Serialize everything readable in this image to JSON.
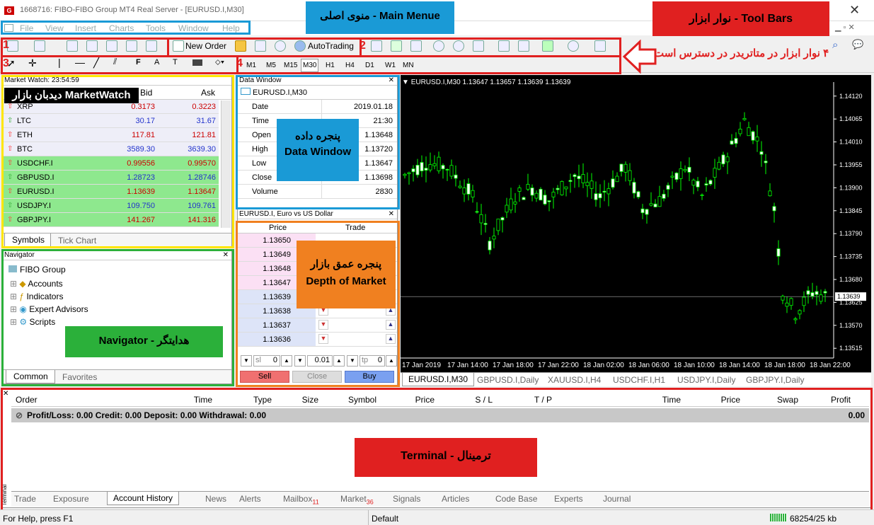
{
  "window": {
    "title": "1668716: FIBO-FIBO Group MT4 Real Server - [EURUSD.I,M30]",
    "logo": "G"
  },
  "menu": [
    "File",
    "View",
    "Insert",
    "Charts",
    "Tools",
    "Window",
    "Help"
  ],
  "toolbar": {
    "new_order": "New Order",
    "autotrading": "AutoTrading",
    "timeframes": [
      "M1",
      "M5",
      "M15",
      "M30",
      "H1",
      "H4",
      "D1",
      "W1",
      "MN"
    ]
  },
  "annotations": {
    "main_menu": "منوی اصلی - Main Menue",
    "toolbars": "نوار ابزار - Tool Bars",
    "toolbars_note": "۴ نوار ابزار در متاتریدر در دسترس است",
    "marketwatch": "دیدبان بازار MarketWatch",
    "data_window_fa": "پنجره داده",
    "data_window_en": "Data Window",
    "dom_fa": "پنجره عمق بازار",
    "dom_en": "Depth of Market",
    "navigator": "Navigator - هدایتگر",
    "terminal": "Terminal - ترمینال",
    "n1": "1",
    "n2": "2",
    "n3": "3",
    "n4": "4"
  },
  "market_watch": {
    "title": "Market Watch: 23:54:59",
    "col_bid": "Bid",
    "col_ask": "Ask",
    "rows": [
      {
        "symbol": "XRP",
        "bid": "0.3173",
        "ask": "0.3223"
      },
      {
        "symbol": "LTC",
        "bid": "30.17",
        "ask": "31.67"
      },
      {
        "symbol": "ETH",
        "bid": "117.81",
        "ask": "121.81"
      },
      {
        "symbol": "BTC",
        "bid": "3589.30",
        "ask": "3639.30"
      },
      {
        "symbol": "USDCHF.I",
        "bid": "0.99556",
        "ask": "0.99570"
      },
      {
        "symbol": "GBPUSD.I",
        "bid": "1.28723",
        "ask": "1.28746"
      },
      {
        "symbol": "EURUSD.I",
        "bid": "1.13639",
        "ask": "1.13647"
      },
      {
        "symbol": "USDJPY.I",
        "bid": "109.750",
        "ask": "109.761"
      },
      {
        "symbol": "GBPJPY.I",
        "bid": "141.267",
        "ask": "141.316"
      }
    ],
    "tabs": [
      "Symbols",
      "Tick Chart"
    ]
  },
  "data_window": {
    "title": "Data Window",
    "symbol": "EURUSD.I,M30",
    "rows": [
      {
        "label": "Date",
        "value": "2019.01.18"
      },
      {
        "label": "Time",
        "value": "21:30"
      },
      {
        "label": "Open",
        "value": "1.13648"
      },
      {
        "label": "High",
        "value": "1.13720"
      },
      {
        "label": "Low",
        "value": "1.13647"
      },
      {
        "label": "Close",
        "value": "1.13698"
      },
      {
        "label": "Volume",
        "value": "2830"
      }
    ]
  },
  "dom": {
    "title": "EURUSD.I, Euro vs US Dollar",
    "col_price": "Price",
    "col_trade": "Trade",
    "prices": [
      "1.13650",
      "1.13649",
      "1.13648",
      "1.13647",
      "1.13639",
      "1.13638",
      "1.13637",
      "1.13636"
    ],
    "sl_label": "sl",
    "sl_value": "0",
    "lot": "0.01",
    "tp_label": "tp",
    "tp_value": "0",
    "sell": "Sell",
    "close": "Close",
    "buy": "Buy"
  },
  "navigator": {
    "title": "Navigator",
    "root": "FIBO Group",
    "items": [
      "Accounts",
      "Indicators",
      "Expert Advisors",
      "Scripts"
    ],
    "tabs": [
      "Common",
      "Favorites"
    ]
  },
  "chart": {
    "header": "EURUSD.I,M30  1.13647 1.13657 1.13639 1.13639",
    "price_labels": [
      "1.14120",
      "1.14065",
      "1.14010",
      "1.13955",
      "1.13900",
      "1.13845",
      "1.13790",
      "1.13735",
      "1.13680",
      "1.13625",
      "1.13570",
      "1.13515"
    ],
    "current_price": "1.13639",
    "time_labels": [
      "17 Jan 2019",
      "17 Jan 14:00",
      "17 Jan 18:00",
      "17 Jan 22:00",
      "18 Jan 02:00",
      "18 Jan 06:00",
      "18 Jan 10:00",
      "18 Jan 14:00",
      "18 Jan 18:00",
      "18 Jan 22:00"
    ],
    "tabs": [
      "EURUSD.I,M30",
      "GBPUSD.I,Daily",
      "XAUUSD.I,H4",
      "USDCHF.I,H1",
      "USDJPY.I,Daily",
      "GBPJPY.I,Daily"
    ]
  },
  "terminal": {
    "columns": [
      "Order",
      "Time",
      "Type",
      "Size",
      "Symbol",
      "Price",
      "S / L",
      "T / P",
      "Time",
      "Price",
      "Swap",
      "Profit"
    ],
    "summary": "Profit/Loss: 0.00  Credit: 0.00  Deposit: 0.00  Withdrawal: 0.00",
    "summary_value": "0.00",
    "side_label": "Terminal",
    "tabs": [
      {
        "label": "Trade",
        "badge": ""
      },
      {
        "label": "Exposure",
        "badge": ""
      },
      {
        "label": "Account History",
        "badge": ""
      },
      {
        "label": "News",
        "badge": ""
      },
      {
        "label": "Alerts",
        "badge": ""
      },
      {
        "label": "Mailbox",
        "badge": "11"
      },
      {
        "label": "Market",
        "badge": "36"
      },
      {
        "label": "Signals",
        "badge": ""
      },
      {
        "label": "Articles",
        "badge": ""
      },
      {
        "label": "Code Base",
        "badge": ""
      },
      {
        "label": "Experts",
        "badge": ""
      },
      {
        "label": "Journal",
        "badge": ""
      }
    ]
  },
  "status": {
    "help": "For Help, press F1",
    "profile": "Default",
    "traffic": "68254/25 kb"
  },
  "colors": {
    "red": "#e02020",
    "blue": "#1a9ad6",
    "yellow": "#ffe600",
    "green": "#2bb03a",
    "orange": "#f08020",
    "mw_green": "#8ee88e"
  }
}
